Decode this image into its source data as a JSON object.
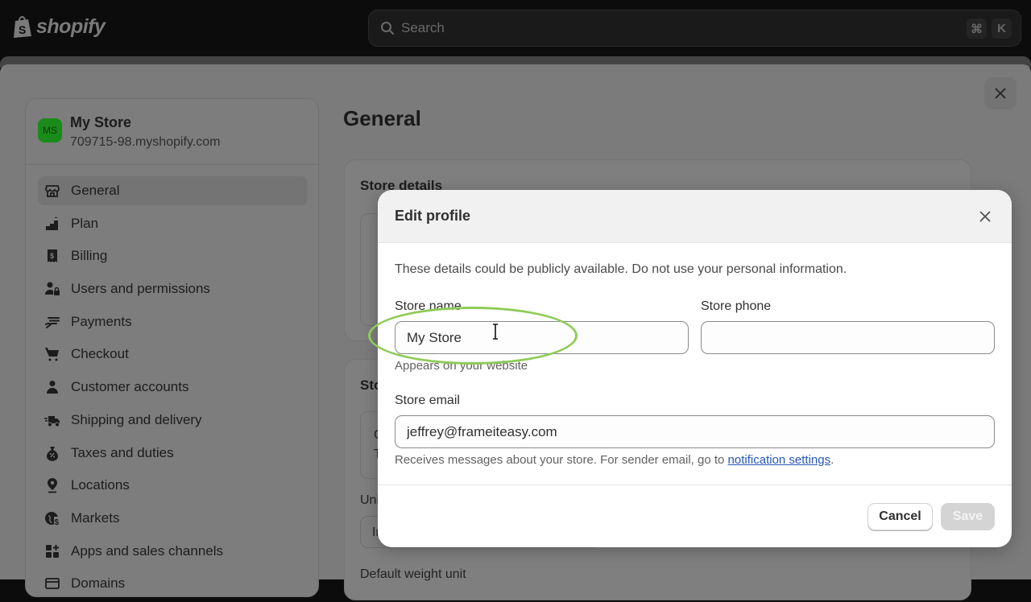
{
  "topbar": {
    "brand": "shopify",
    "search_placeholder": "Search",
    "shortcut_keys": [
      "⌘",
      "K"
    ]
  },
  "settings": {
    "store": {
      "initials": "MS",
      "name": "My Store",
      "domain": "709715-98.myshopify.com",
      "avatar_color": "#1a8a1a"
    },
    "nav": [
      {
        "label": "General",
        "icon": "store-icon",
        "active": true
      },
      {
        "label": "Plan",
        "icon": "plan-icon",
        "active": false
      },
      {
        "label": "Billing",
        "icon": "billing-icon",
        "active": false
      },
      {
        "label": "Users and permissions",
        "icon": "users-icon",
        "active": false
      },
      {
        "label": "Payments",
        "icon": "payments-icon",
        "active": false
      },
      {
        "label": "Checkout",
        "icon": "cart-icon",
        "active": false
      },
      {
        "label": "Customer accounts",
        "icon": "person-icon",
        "active": false
      },
      {
        "label": "Shipping and delivery",
        "icon": "truck-icon",
        "active": false
      },
      {
        "label": "Taxes and duties",
        "icon": "tax-icon",
        "active": false
      },
      {
        "label": "Locations",
        "icon": "location-icon",
        "active": false
      },
      {
        "label": "Markets",
        "icon": "globe-icon",
        "active": false
      },
      {
        "label": "Apps and sales channels",
        "icon": "apps-icon",
        "active": false
      },
      {
        "label": "Domains",
        "icon": "domains-icon",
        "active": false
      }
    ],
    "page_title": "General",
    "cards": {
      "store_details_title": "Store details",
      "store_defaults_title": "Store defaults",
      "inner_line_a": "C",
      "inner_line_b": "T",
      "unit_system_label": "Unit system",
      "unit_system_value": "International system",
      "default_weight_label": "Default weight unit"
    }
  },
  "modal": {
    "title": "Edit profile",
    "notice": "These details could be publicly available. Do not use your personal information.",
    "store_name": {
      "label": "Store name",
      "value": "My Store",
      "help": "Appears on your website"
    },
    "store_phone": {
      "label": "Store phone",
      "value": ""
    },
    "store_email": {
      "label": "Store email",
      "value": "jeffrey@frameiteasy.com",
      "help_prefix": "Receives messages about your store. For sender email, go to ",
      "help_link": "notification settings",
      "help_suffix": "."
    },
    "cancel_label": "Cancel",
    "save_label": "Save",
    "save_enabled": false
  },
  "annotation": {
    "highlight_color": "#8ecb57",
    "target": "store-name-input"
  }
}
